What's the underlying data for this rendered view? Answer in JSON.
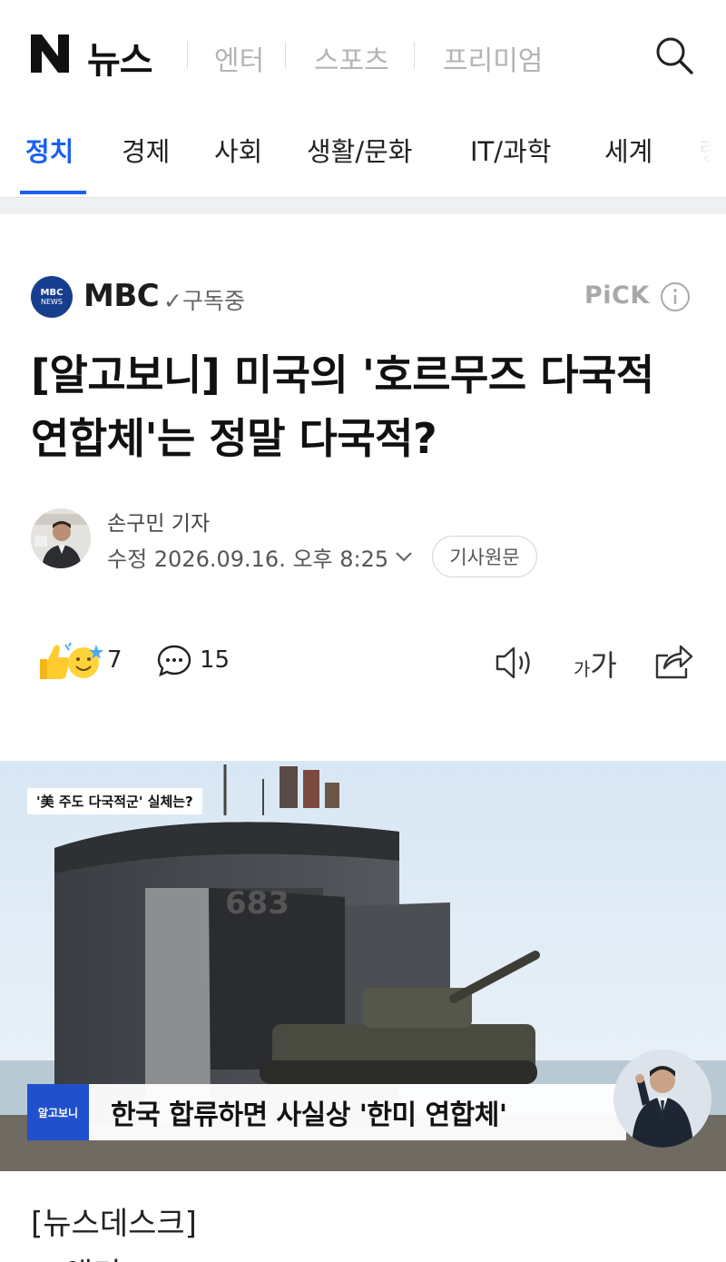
{
  "header": {
    "logo_letter": "N",
    "logo_text": "뉴스",
    "tabs": [
      "엔터",
      "스포츠",
      "프리미엄"
    ],
    "search_icon": "search-icon"
  },
  "category_nav": {
    "active_index": 0,
    "active_color": "#1a5ff5",
    "items": [
      "정치",
      "경제",
      "사회",
      "생활/문화",
      "IT/과학",
      "세계",
      "랭"
    ]
  },
  "press": {
    "logo_line1": "MBC",
    "logo_line2": "NEWS",
    "name": "MBC",
    "subscribe_status": "✓구독중",
    "pick_label": "PiCK",
    "info_icon": "info-icon"
  },
  "article": {
    "headline": "[알고보니] 미국의 '호르무즈 다국적 연합체'는 정말 다국적?",
    "reporter_name": "손구민 기자",
    "date": "수정 2026.09.16. 오후 8:25",
    "origin_button": "기사원문",
    "reaction_count": "7",
    "comment_count": "15",
    "font_size_small": "가",
    "font_size_large": "가"
  },
  "image": {
    "tag_text": "'美 주도 다국적군' 실체는?",
    "ship_number": "683",
    "caption_badge": "알고보니",
    "caption_text": "한국 합류하면 사실상 '한미 연합체'"
  },
  "body": {
    "line1": "[뉴스데스크]",
    "line2": "◀ 앵커 ▶"
  }
}
